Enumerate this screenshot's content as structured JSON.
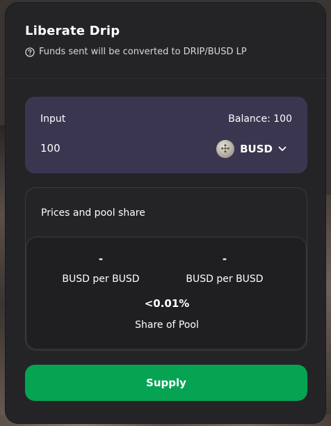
{
  "modal": {
    "title": "Liberate Drip",
    "subtitle": "Funds sent will be converted to DRIP/BUSD LP"
  },
  "input_panel": {
    "label": "Input",
    "balance": "Balance: 100",
    "amount": "100",
    "token": {
      "symbol": "BUSD",
      "icon": "busd-token-icon"
    }
  },
  "pool": {
    "title": "Prices and pool share",
    "price_a": {
      "value": "-",
      "label": "BUSD per BUSD"
    },
    "price_b": {
      "value": "-",
      "label": "BUSD per BUSD"
    },
    "share": {
      "value": "<0.01%",
      "label": "Share of Pool"
    }
  },
  "actions": {
    "supply_label": "Supply"
  },
  "colors": {
    "card_bg": "#242427",
    "input_bg": "#3b3650",
    "accent_green": "#05a352"
  }
}
